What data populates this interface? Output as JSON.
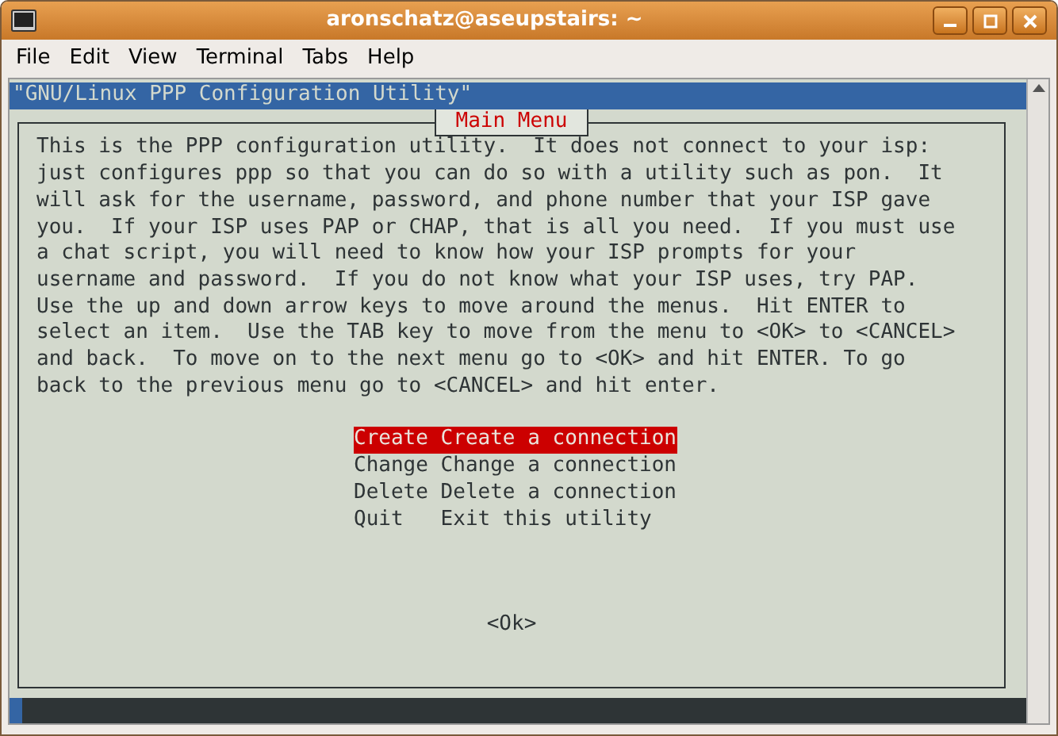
{
  "window": {
    "title": "aronschatz@aseupstairs: ~"
  },
  "menu": [
    {
      "label": "File"
    },
    {
      "label": "Edit"
    },
    {
      "label": "View"
    },
    {
      "label": "Terminal"
    },
    {
      "label": "Tabs"
    },
    {
      "label": "Help"
    }
  ],
  "backtitle": "\"GNU/Linux PPP Configuration Utility\"",
  "dialog": {
    "title": "Main Menu",
    "message_lines": [
      "This is the PPP configuration utility.  It does not connect to your isp:",
      "just configures ppp so that you can do so with a utility such as pon.  It",
      "will ask for the username, password, and phone number that your ISP gave",
      "you.  If your ISP uses PAP or CHAP, that is all you need.  If you must use",
      "a chat script, you will need to know how your ISP prompts for your",
      "username and password.  If you do not know what your ISP uses, try PAP.",
      "Use the up and down arrow keys to move around the menus.  Hit ENTER to",
      "select an item.  Use the TAB key to move from the menu to <OK> to <CANCEL>",
      "and back.  To move on to the next menu go to <OK> and hit ENTER. To go",
      "back to the previous menu go to <CANCEL> and hit enter."
    ],
    "items": [
      {
        "tag": "Create",
        "description": "Create a connection",
        "selected": true
      },
      {
        "tag": "Change",
        "description": "Change a connection",
        "selected": false
      },
      {
        "tag": "Delete",
        "description": "Delete a connection",
        "selected": false
      },
      {
        "tag": "Quit",
        "description": "Exit this utility",
        "selected": false
      }
    ],
    "button": "<Ok>"
  }
}
